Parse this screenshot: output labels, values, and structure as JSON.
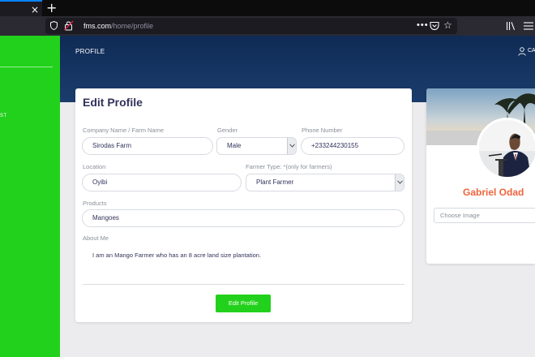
{
  "browser": {
    "tab_close": "×",
    "new_tab": "+",
    "url_host": "fms.com",
    "url_path": "/home/profile",
    "page_actions": "•••",
    "bookmark_star": "☆"
  },
  "sidebar": {
    "item_label": "ST"
  },
  "header": {
    "title": "PROFILE",
    "user_label": "CA"
  },
  "form": {
    "title": "Edit Profile",
    "company": {
      "label": "Company Name / Farm Name",
      "value": "Sirodas Farm"
    },
    "gender": {
      "label": "Gender",
      "value": "Male"
    },
    "phone": {
      "label": "Phone Number",
      "value": "+233244230155"
    },
    "location": {
      "label": "Location",
      "value": "Oyibi"
    },
    "farmer_type": {
      "label": "Farmer Type: *(only for farmers)",
      "value": "Plant Farmer"
    },
    "products": {
      "label": "Products",
      "value": "Mangoes"
    },
    "about": {
      "label": "About Me",
      "value": "I am an Mango Farmer who has an 8 acre land size plantation."
    },
    "submit_label": "Edit Profile"
  },
  "profile": {
    "name": "Gabriel Odad",
    "choose_image": "Choose Image"
  },
  "colors": {
    "accent": "#22d11b",
    "header": "#0f2b55",
    "name": "#f0643c"
  }
}
